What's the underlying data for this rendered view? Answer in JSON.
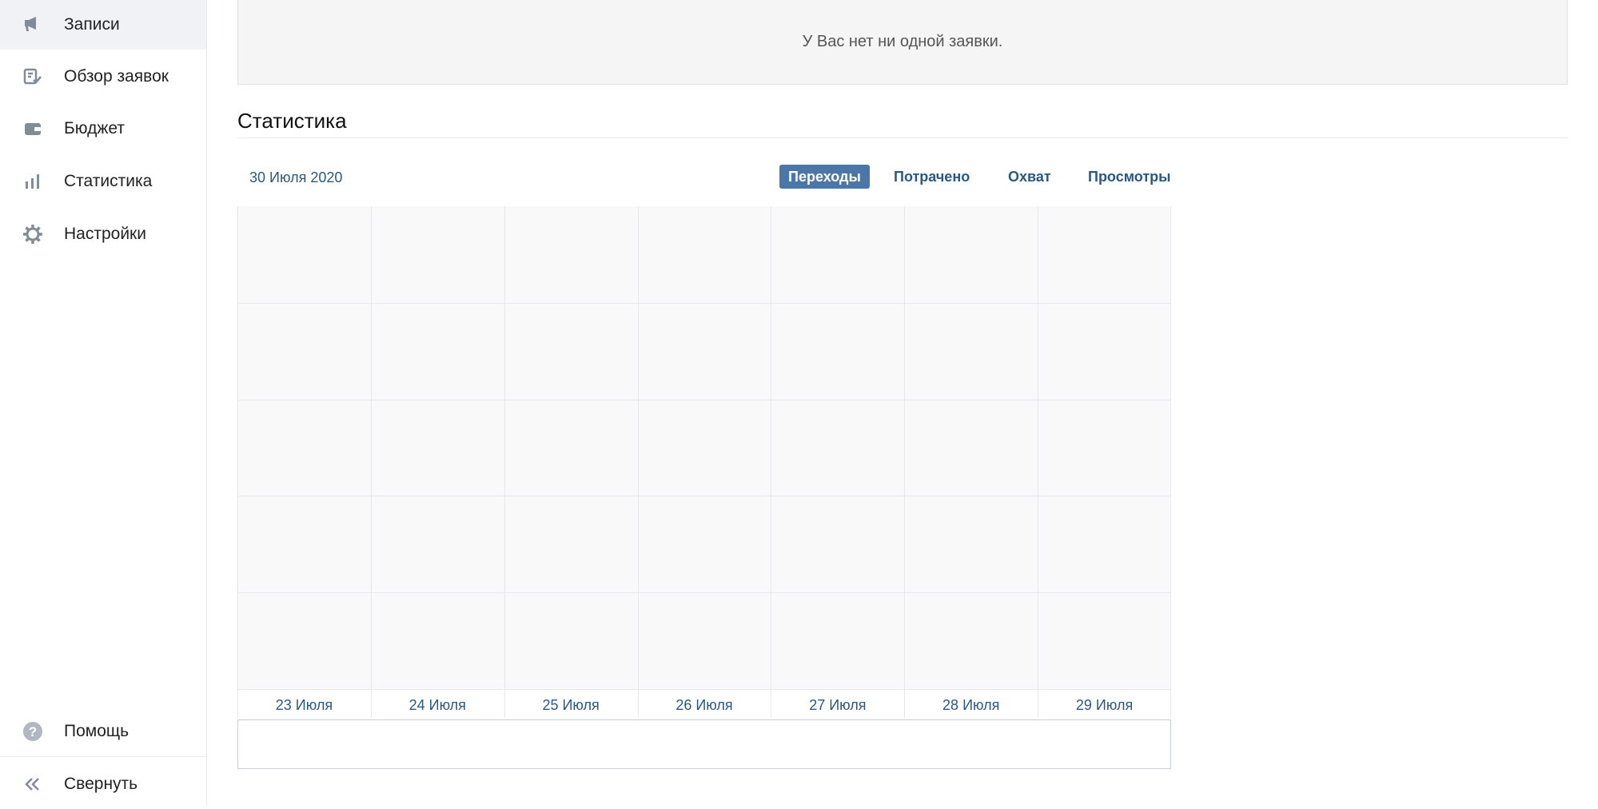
{
  "sidebar": {
    "items": [
      {
        "label": "Записи",
        "icon": "megaphone-icon"
      },
      {
        "label": "Обзор заявок",
        "icon": "request-review-icon"
      },
      {
        "label": "Бюджет",
        "icon": "wallet-icon"
      },
      {
        "label": "Статистика",
        "icon": "bar-chart-icon"
      },
      {
        "label": "Настройки",
        "icon": "gear-icon"
      }
    ],
    "help_label": "Помощь",
    "collapse_label": "Свернуть"
  },
  "notice": {
    "text": "У Вас нет ни одной заявки."
  },
  "stats": {
    "title": "Статистика",
    "date": "30 Июля 2020",
    "tabs": [
      "Переходы",
      "Потрачено",
      "Охват",
      "Просмотры"
    ],
    "active_tab": "Переходы"
  },
  "colors": {
    "accent": "#4a76a8",
    "link": "#2a5885",
    "chart_bg": "#f9f9f9",
    "grid": "#e6e8ec"
  },
  "chart_data": {
    "type": "bar",
    "categories": [
      "23 Июля",
      "24 Июля",
      "25 Июля",
      "26 Июля",
      "27 Июля",
      "28 Июля",
      "29 Июля"
    ],
    "series": [],
    "grid": true
  }
}
